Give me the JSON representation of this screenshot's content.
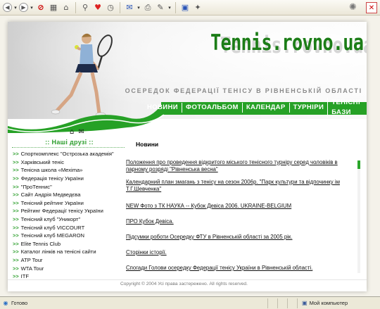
{
  "browser": {
    "toolbar_icons": [
      "back-icon",
      "forward-icon",
      "stop-icon",
      "refresh-icon",
      "home-icon",
      "search-icon",
      "favorites-icon",
      "history-icon",
      "mail-icon",
      "print-icon",
      "edit-icon",
      "discuss-icon"
    ],
    "status_text": "Готово",
    "zone_text": "Мой компьютер"
  },
  "site": {
    "logo": "Tennis.rovno.ua",
    "tagline": "ОСЕРЕДОК ФЕДЕРАЦІЇ ТЕНІСУ В РІВНЕНСЬКІЙ ОБЛАСТІ",
    "nav": [
      "НОВИНИ",
      "ФОТОАЛЬБОМ",
      "КАЛЕНДАР",
      "ТУРНІРИ",
      "ТЕНІСНІ БАЗИ"
    ],
    "friends_title": ":: Наші друзі ::",
    "links": [
      "Спорткомплекс \"Острозька академія\"",
      "Харківський теніс",
      "Тенісна школа «Mехіma»",
      "Федерація тенісу України",
      "\"ПроТеннис\"",
      "Сайт Андрія Медведєва",
      "Тенісний рейтинг України",
      "Рейтинг Федерації тенісу України",
      "Тенісний клуб \"Уникорт\"",
      "Тенісний клуб VICCOURT",
      "Тенісний клуб MEGARON",
      "Elite Tennis Club",
      "Каталог лінків на тенісні сайти",
      "ATP Tour",
      "WTA Tour",
      "ITF"
    ],
    "section_title": "Новини",
    "news": [
      "Положення про проведення відкритого міського тенісного турніру серед чоловіків в парному розряді \"Рівненська весна\"",
      "Календарний план змагань з тенісу на сезон 2006р. \"Парк культури та відпочинку ім Т.Г.Шевченка\"",
      "NEW Фото з ТК НАУКА -- Кубок Девіса 2006. UKRAINE-BELGIUM",
      "ПРО Кубок Девіса.",
      "Підсумки роботи Осередку ФТУ в Рівненській області за 2005 рік.",
      "Сторінки історії.",
      "Спогади Голови осередку Федерації тенісу України в Рівненській області."
    ],
    "copyright": "Copyright © 2004 Усі права застережено. All rights reserved.",
    "colors": {
      "accent_green": "#26a126",
      "logo_green": "#1c7d17"
    }
  }
}
